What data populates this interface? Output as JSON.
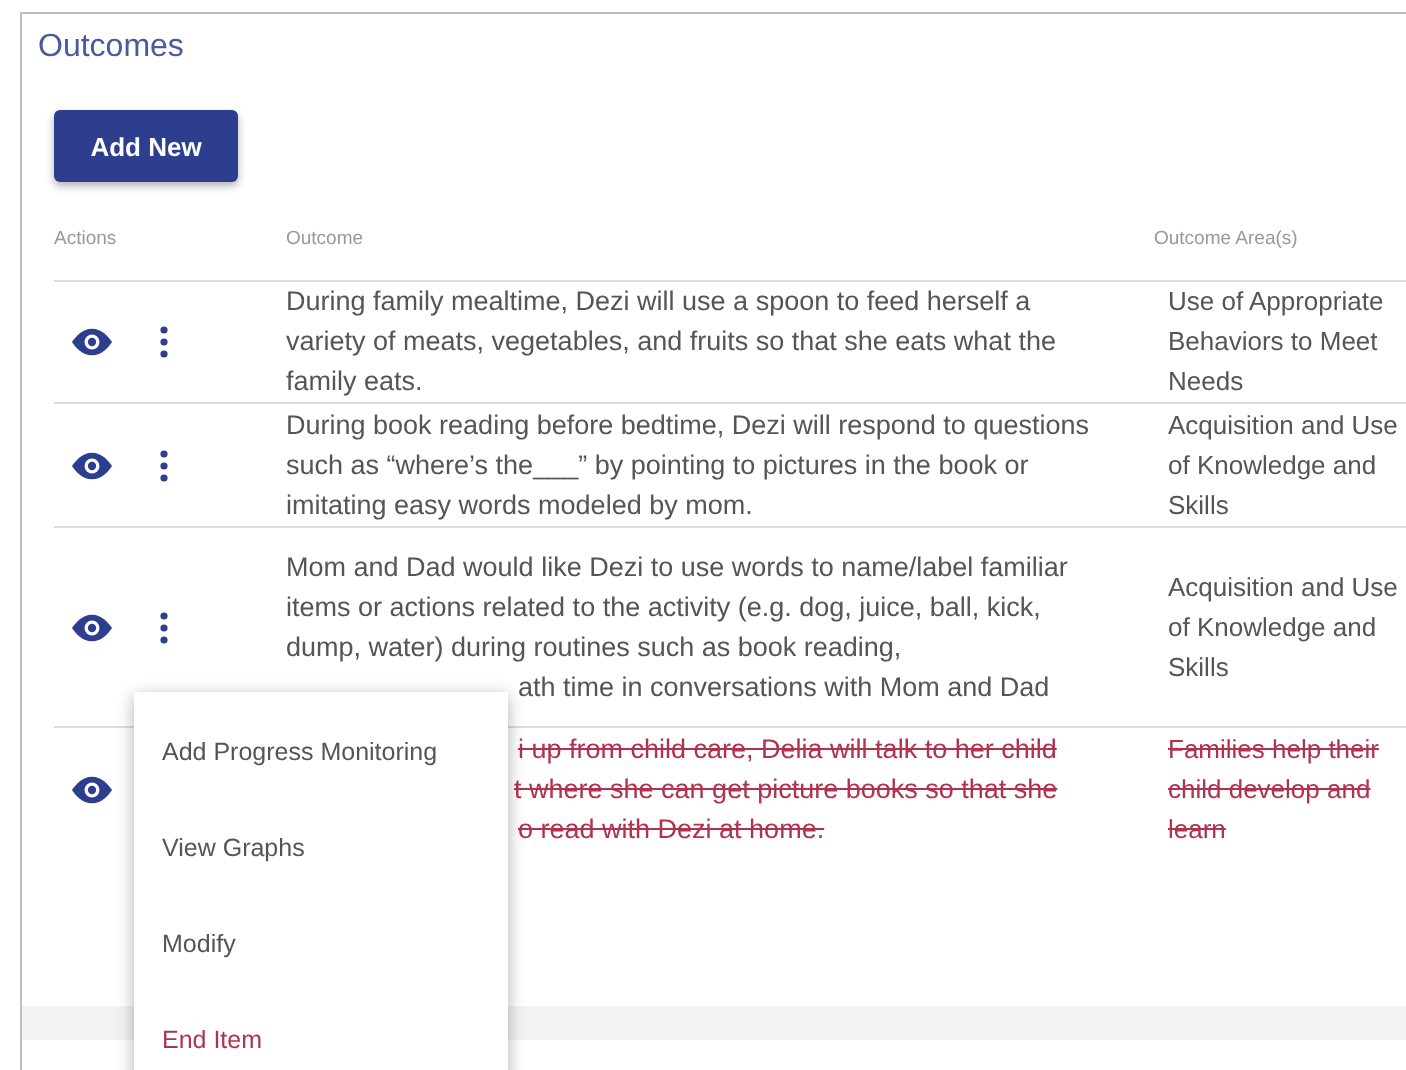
{
  "title": "Outcomes",
  "add_button": "Add New",
  "columns": [
    "Actions",
    "Outcome",
    "Outcome Area(s)"
  ],
  "rows": [
    {
      "ended": false,
      "outcome": [
        "During family mealtime, Dezi will use a spoon to feed herself a variety of meats, vegetables, and fruits so that she eats what the family eats."
      ],
      "area": "Use of Appropriate Behaviors to Meet Needs"
    },
    {
      "ended": false,
      "outcome": [
        "During book reading before bedtime, Dezi will respond to questions such as “where’s the___” by pointing to pictures in the book or imitating easy words modeled by mom."
      ],
      "area": "Acquisition and Use of Knowledge and Skills"
    },
    {
      "ended": false,
      "outcome": [
        "Mom and Dad would like Dezi to use words to name/label familiar items or actions related to the activity (e.g. dog, juice, ball, kick, dump, water) during routines such as book reading,",
        "ath time in conversations with Mom and Dad"
      ],
      "area": "Acquisition and Use of Knowledge and Skills",
      "menu": [
        {
          "label": "Add Progress Monitoring",
          "kind": "normal"
        },
        {
          "label": "View Graphs",
          "kind": "normal"
        },
        {
          "label": "Modify",
          "kind": "normal"
        },
        {
          "label": "End Item",
          "kind": "danger"
        }
      ]
    },
    {
      "ended": true,
      "outcome": [
        "i up from child care, Delia will talk to her child",
        "t where she can get picture books so that she",
        "o read with Dezi at home."
      ],
      "area": "Families help their child develop and learn"
    }
  ]
}
